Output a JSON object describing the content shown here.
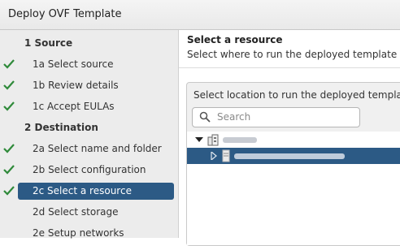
{
  "window": {
    "title": "Deploy OVF Template"
  },
  "steps": [
    {
      "label": "1  Source",
      "type": "section",
      "done": false,
      "active": false
    },
    {
      "label": "1a  Select source",
      "type": "sub",
      "done": true,
      "active": false
    },
    {
      "label": "1b  Review details",
      "type": "sub",
      "done": true,
      "active": false
    },
    {
      "label": "1c  Accept EULAs",
      "type": "sub",
      "done": true,
      "active": false
    },
    {
      "label": "2  Destination",
      "type": "section",
      "done": false,
      "active": false
    },
    {
      "label": "2a  Select name and folder",
      "type": "sub",
      "done": true,
      "active": false
    },
    {
      "label": "2b  Select configuration",
      "type": "sub",
      "done": true,
      "active": false
    },
    {
      "label": "2c  Select a resource",
      "type": "sub",
      "done": true,
      "active": true
    },
    {
      "label": "2d  Select storage",
      "type": "sub",
      "done": false,
      "active": false
    },
    {
      "label": "2e  Setup networks",
      "type": "sub",
      "done": false,
      "active": false
    }
  ],
  "main": {
    "heading": "Select a resource",
    "subheading": "Select where to run the deployed template",
    "panel_title": "Select location to run the deployed template",
    "search_placeholder": "Search"
  },
  "colors": {
    "check": "#2f8a3a",
    "selection": "#2c5a85"
  },
  "icons": {
    "check": "checkmark-icon",
    "search": "search-icon",
    "datacenter": "datacenter-icon",
    "host": "host-icon"
  }
}
